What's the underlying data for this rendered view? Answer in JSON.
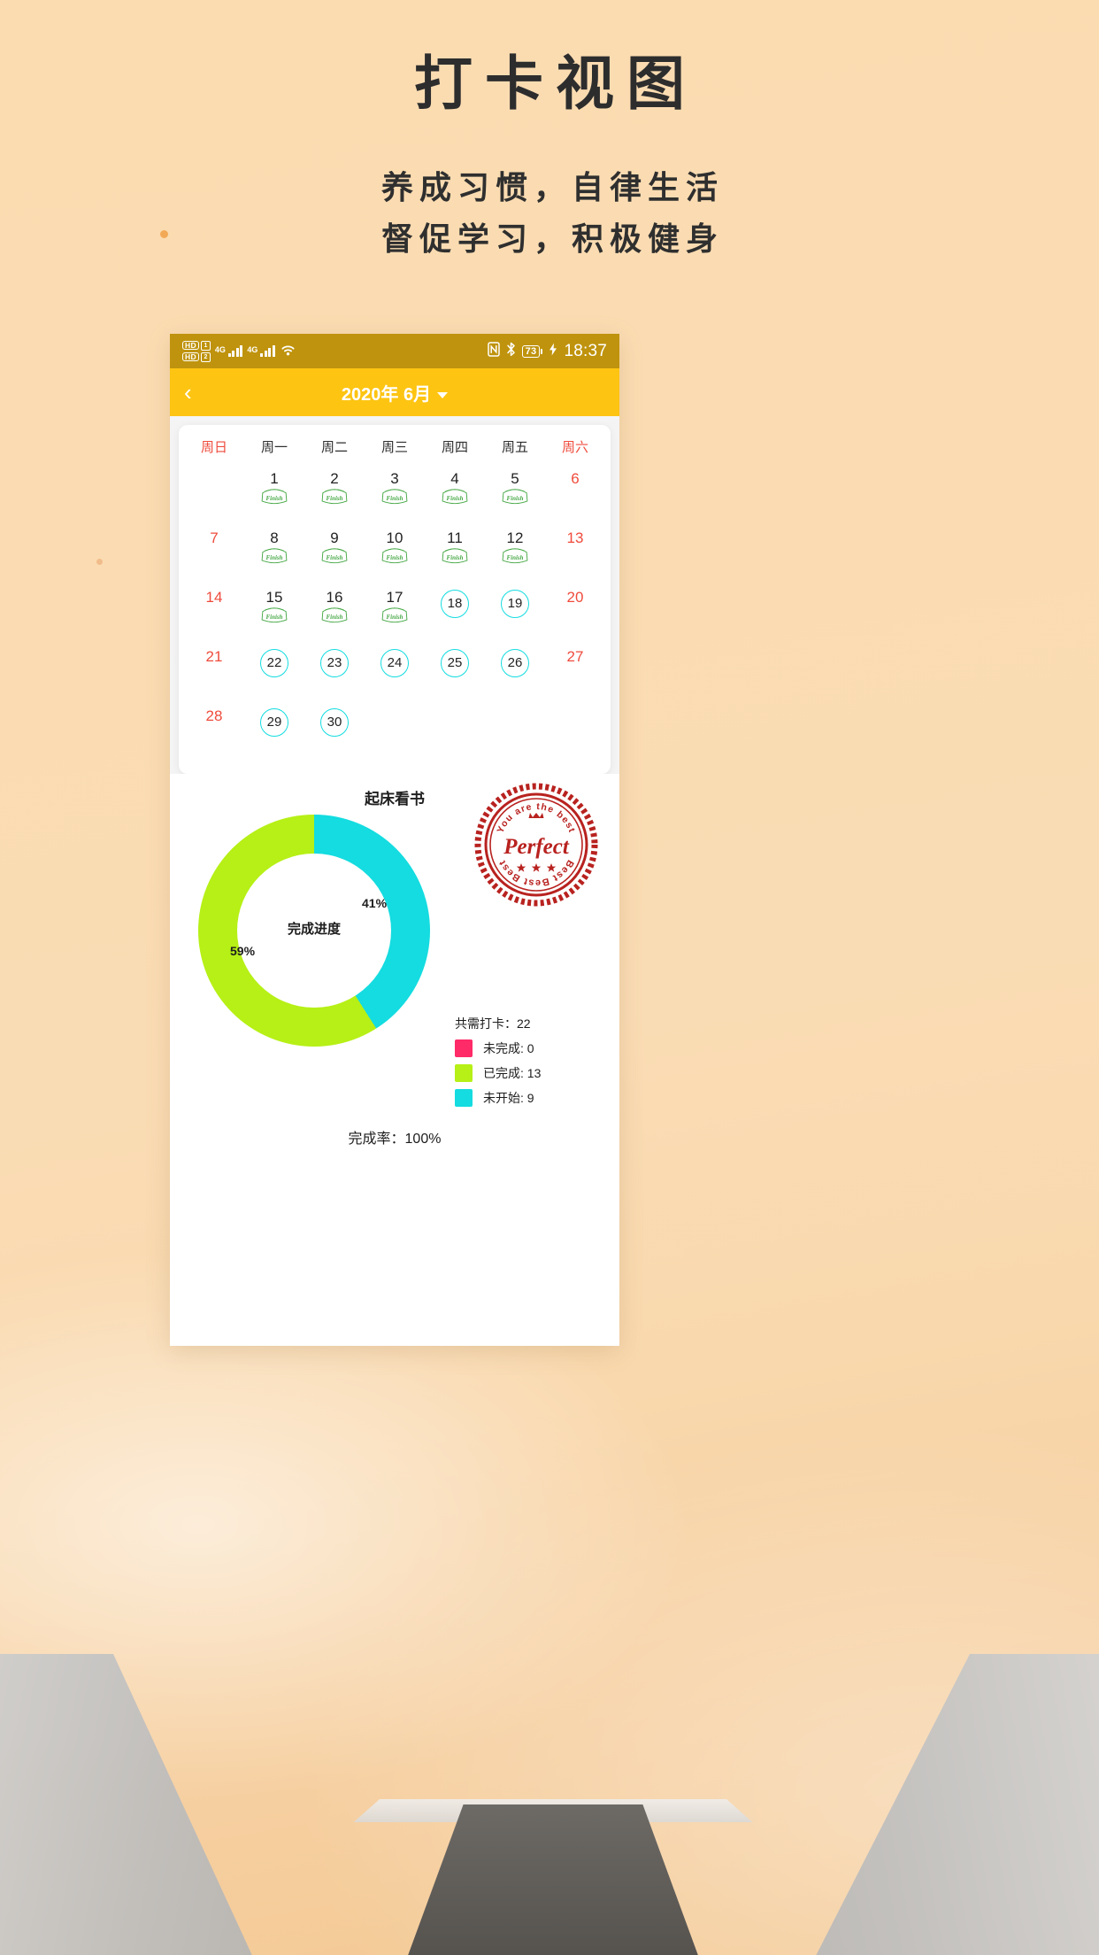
{
  "hero": {
    "title": "打卡视图",
    "subtitle_line1": "养成习惯，自律生活",
    "subtitle_line2": "督促学习，积极健身"
  },
  "statusbar": {
    "hd1_label": "HD",
    "hd1_slot": "1",
    "hd2_label": "HD",
    "hd2_slot": "2",
    "net1": "4G",
    "net2": "4G",
    "nfc_icon": "nfc-icon",
    "bluetooth_icon": "bluetooth-icon",
    "battery_level": "73",
    "charging_icon": "charging-bolt-icon",
    "time": "18:37"
  },
  "appbar": {
    "back_icon": "chevron-left-icon",
    "title": "2020年 6月",
    "dropdown_icon": "chevron-down-icon"
  },
  "calendar": {
    "weekdays": [
      {
        "label": "周日",
        "weekend": true
      },
      {
        "label": "周一",
        "weekend": false
      },
      {
        "label": "周二",
        "weekend": false
      },
      {
        "label": "周三",
        "weekend": false
      },
      {
        "label": "周四",
        "weekend": false
      },
      {
        "label": "周五",
        "weekend": false
      },
      {
        "label": "周六",
        "weekend": true
      }
    ],
    "stamp_text": "Finish",
    "weeks": [
      [
        {
          "day": "",
          "state": "empty"
        },
        {
          "day": "1",
          "state": "finished"
        },
        {
          "day": "2",
          "state": "finished"
        },
        {
          "day": "3",
          "state": "finished"
        },
        {
          "day": "4",
          "state": "finished"
        },
        {
          "day": "5",
          "state": "finished"
        },
        {
          "day": "6",
          "state": "weekend"
        }
      ],
      [
        {
          "day": "7",
          "state": "weekend"
        },
        {
          "day": "8",
          "state": "finished"
        },
        {
          "day": "9",
          "state": "finished"
        },
        {
          "day": "10",
          "state": "finished"
        },
        {
          "day": "11",
          "state": "finished"
        },
        {
          "day": "12",
          "state": "finished"
        },
        {
          "day": "13",
          "state": "weekend"
        }
      ],
      [
        {
          "day": "14",
          "state": "weekend"
        },
        {
          "day": "15",
          "state": "finished"
        },
        {
          "day": "16",
          "state": "finished"
        },
        {
          "day": "17",
          "state": "finished"
        },
        {
          "day": "18",
          "state": "pending"
        },
        {
          "day": "19",
          "state": "pending"
        },
        {
          "day": "20",
          "state": "weekend"
        }
      ],
      [
        {
          "day": "21",
          "state": "weekend"
        },
        {
          "day": "22",
          "state": "pending"
        },
        {
          "day": "23",
          "state": "pending"
        },
        {
          "day": "24",
          "state": "pending"
        },
        {
          "day": "25",
          "state": "pending"
        },
        {
          "day": "26",
          "state": "pending"
        },
        {
          "day": "27",
          "state": "weekend"
        }
      ],
      [
        {
          "day": "28",
          "state": "weekend"
        },
        {
          "day": "29",
          "state": "pending"
        },
        {
          "day": "30",
          "state": "pending"
        },
        {
          "day": "",
          "state": "empty"
        },
        {
          "day": "",
          "state": "empty"
        },
        {
          "day": "",
          "state": "empty"
        },
        {
          "day": "",
          "state": "empty"
        }
      ]
    ]
  },
  "stamp_badge": {
    "top_text": "You are the best",
    "main_text": "Perfect",
    "bottom_text": "Best Best Best",
    "color": "#b8221f"
  },
  "chart_data": {
    "type": "pie",
    "title": "起床看书",
    "center_label": "完成进度",
    "labels": [
      "未开始",
      "已完成"
    ],
    "values": [
      41,
      59
    ],
    "value_labels": [
      "41%",
      "59%"
    ],
    "colors": [
      "#14dce0",
      "#b6f016"
    ],
    "legend_position": "right"
  },
  "legend": {
    "total_label": "共需打卡：",
    "total_value": "22",
    "rows": [
      {
        "label": "未完成: 0",
        "color": "#ff2a68"
      },
      {
        "label": "已完成: 13",
        "color": "#b6f016"
      },
      {
        "label": "未开始: 9",
        "color": "#14dce0"
      }
    ]
  },
  "completion": {
    "rate_text": "完成率：100%"
  }
}
